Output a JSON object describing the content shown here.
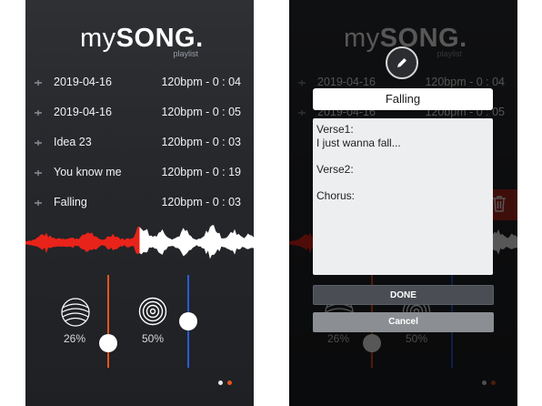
{
  "app": {
    "logo_my": "my",
    "logo_song": "SONG.",
    "logo_sub": "playlist"
  },
  "songs": [
    {
      "title": "2019-04-16",
      "meta": "120bpm - 0 : 04"
    },
    {
      "title": "2019-04-16",
      "meta": "120bpm - 0 : 05"
    },
    {
      "title": "Idea 23",
      "meta": "120bpm - 0 : 03"
    },
    {
      "title": "You know me",
      "meta": "120bpm - 0 : 19"
    },
    {
      "title": "Falling",
      "meta": "120bpm - 0 : 03"
    }
  ],
  "controls": {
    "reverb_percent": "26%",
    "echo_percent": "50%",
    "reverb_level": 0.26,
    "echo_level": 0.5,
    "playback_progress": 0.5,
    "accent_red": "#e8231a",
    "accent_blue": "#2a5bd8",
    "accent_orange": "#e8541e"
  },
  "pager": {
    "pages": 2,
    "active_index": 1
  },
  "editor": {
    "title_value": "Falling",
    "lyrics_value": "Verse1:\nI just wanna fall...\n\nVerse2:\n\nChorus:",
    "done_label": "DONE",
    "cancel_label": "Cancel",
    "edit_icon": "pencil-icon",
    "delete_icon": "trash-icon"
  }
}
